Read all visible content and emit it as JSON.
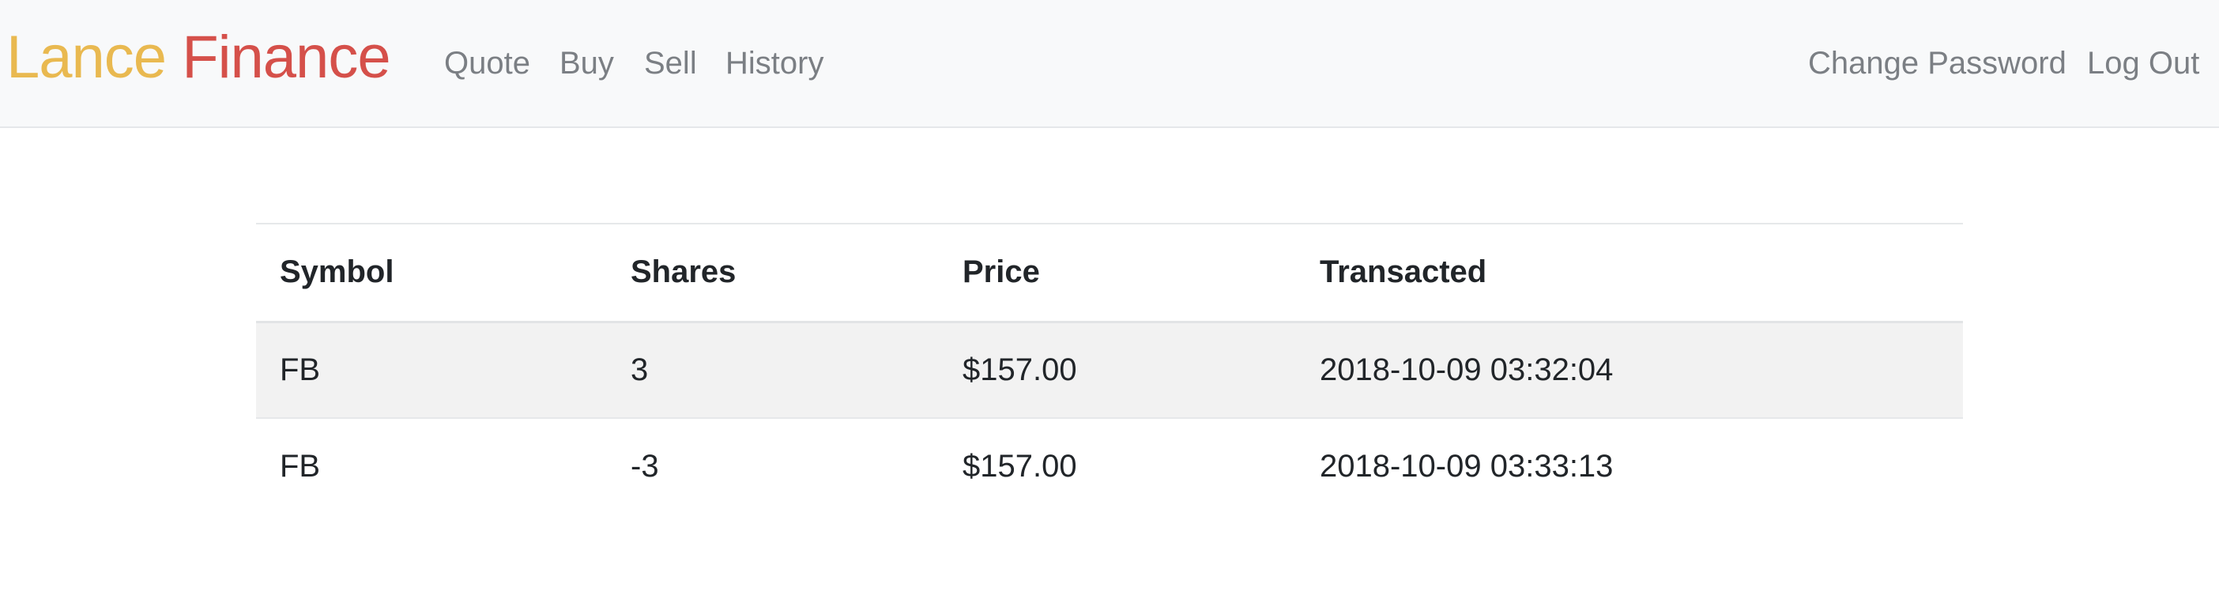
{
  "navbar": {
    "brand_first": "Lance",
    "brand_second": "Finance",
    "brand_colors": {
      "first": "#e9b950",
      "second": "#d5504a"
    },
    "left_links": [
      "Quote",
      "Buy",
      "Sell",
      "History"
    ],
    "right_links": [
      "Change Password",
      "Log Out"
    ]
  },
  "table": {
    "headers": [
      "Symbol",
      "Shares",
      "Price",
      "Transacted"
    ],
    "rows": [
      [
        "FB",
        "3",
        "$157.00",
        "2018-10-09 03:32:04"
      ],
      [
        "FB",
        "-3",
        "$157.00",
        "2018-10-09 03:33:13"
      ]
    ]
  }
}
